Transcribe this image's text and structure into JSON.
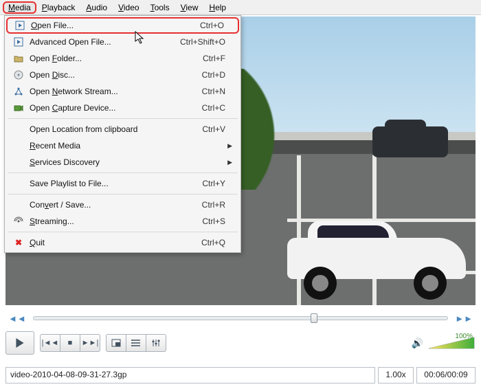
{
  "menubar": [
    "Media",
    "Playback",
    "Audio",
    "Video",
    "Tools",
    "View",
    "Help"
  ],
  "menubar_open_index": 0,
  "dropdown": {
    "items": [
      {
        "icon": "play-file",
        "label": "Open File...",
        "u": 0,
        "shortcut": "Ctrl+O",
        "hl": true
      },
      {
        "icon": "play-file",
        "label": "Advanced Open File...",
        "u": -1,
        "shortcut": "Ctrl+Shift+O"
      },
      {
        "icon": "folder",
        "label": "Open Folder...",
        "u": 5,
        "shortcut": "Ctrl+F"
      },
      {
        "icon": "disc",
        "label": "Open Disc...",
        "u": 5,
        "shortcut": "Ctrl+D"
      },
      {
        "icon": "network",
        "label": "Open Network Stream...",
        "u": 5,
        "shortcut": "Ctrl+N"
      },
      {
        "icon": "capture",
        "label": "Open Capture Device...",
        "u": 5,
        "shortcut": "Ctrl+C"
      },
      {
        "sep": true
      },
      {
        "icon": "",
        "label": "Open Location from clipboard",
        "u": -1,
        "shortcut": "Ctrl+V"
      },
      {
        "icon": "",
        "label": "Recent Media",
        "u": 0,
        "submenu": true
      },
      {
        "icon": "",
        "label": "Services Discovery",
        "u": 0,
        "submenu": true
      },
      {
        "sep": true
      },
      {
        "icon": "",
        "label": "Save Playlist to File...",
        "u": -1,
        "shortcut": "Ctrl+Y"
      },
      {
        "sep": true
      },
      {
        "icon": "",
        "label": "Convert / Save...",
        "u": 3,
        "shortcut": "Ctrl+R"
      },
      {
        "icon": "stream",
        "label": "Streaming...",
        "u": 0,
        "shortcut": "Ctrl+S"
      },
      {
        "sep": true
      },
      {
        "icon": "quit",
        "label": "Quit",
        "u": 0,
        "shortcut": "Ctrl+Q"
      }
    ]
  },
  "seek_percent": 67,
  "volume": {
    "percent_label": "100%"
  },
  "status": {
    "filename": "video-2010-04-08-09-31-27.3gp",
    "speed": "1.00x",
    "time": "00:06/00:09"
  }
}
